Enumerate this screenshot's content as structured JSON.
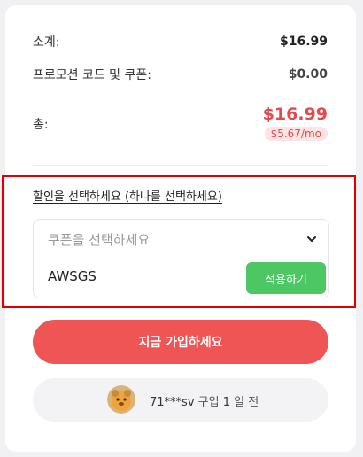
{
  "summary": {
    "subtotal_label": "소계:",
    "subtotal_value": "$16.99",
    "promo_label": "프로모션 코드 및 쿠폰:",
    "promo_value": "$0.00",
    "total_label": "총:",
    "total_value": "$16.99",
    "per_month": "$5.67/mo"
  },
  "discount": {
    "title": "할인을 선택하세요 (하나를 선택하세요)",
    "select_placeholder": "쿠폰을 선택하세요",
    "coupon_code": "AWSGS",
    "apply_label": "적용하기"
  },
  "signup": {
    "label": "지금 가입하세요"
  },
  "activity": {
    "user": "71***sv",
    "text_a": " 구입 ",
    "number": "1",
    "text_b": " 일 전"
  },
  "colors": {
    "accent_red": "#ee5554",
    "apply_green": "#4cc764",
    "price_red": "#e8484b",
    "highlight_border": "#e00000"
  },
  "icons": {
    "select_chevron": "chevron-down-icon",
    "avatar": "avatar"
  }
}
